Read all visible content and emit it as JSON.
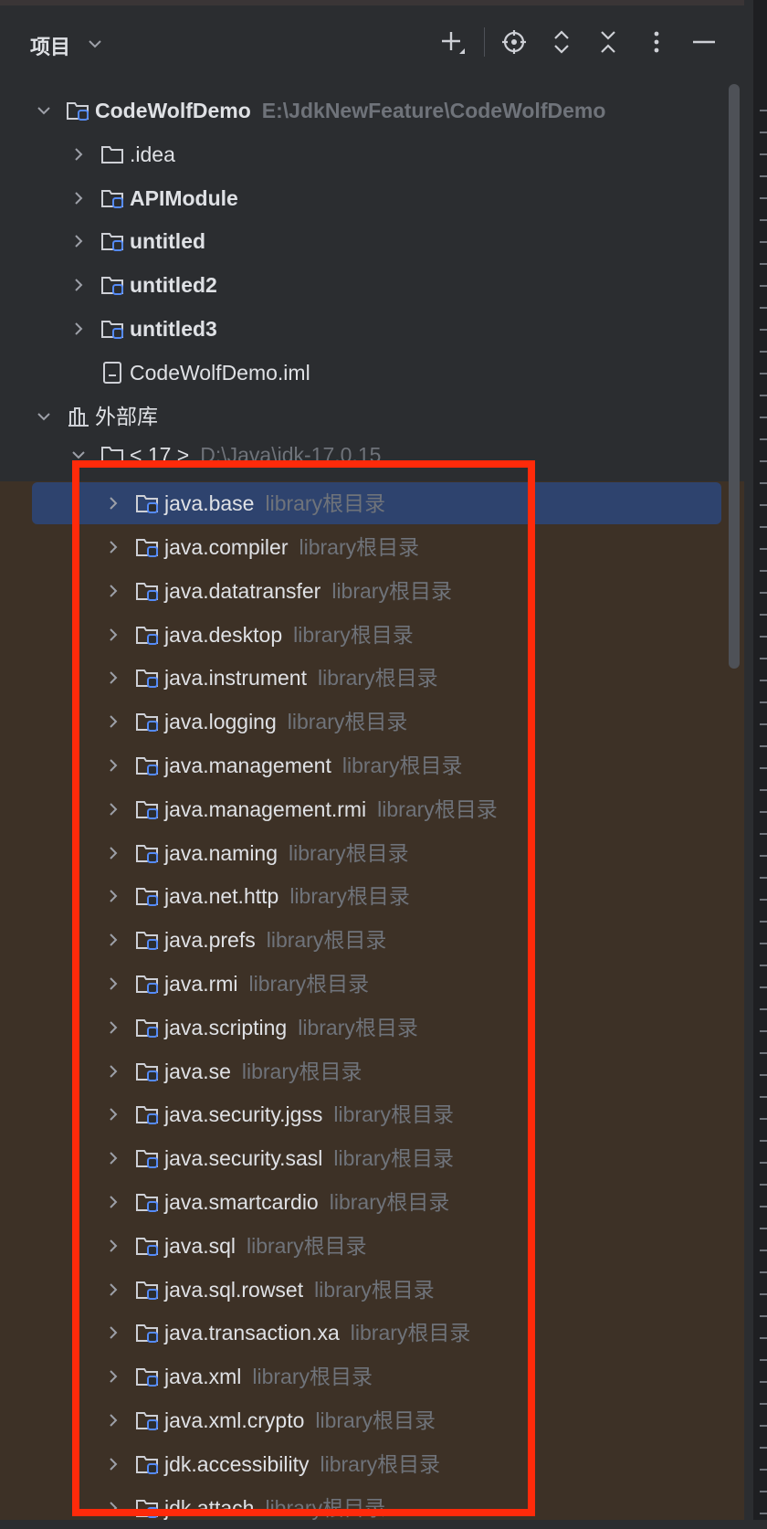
{
  "panel": {
    "title": "项目"
  },
  "toolbar": {
    "icons": [
      "add-icon",
      "locate-icon",
      "expand-icon",
      "collapse-icon",
      "more-icon",
      "minimize-icon"
    ]
  },
  "tree": {
    "root": {
      "name": "CodeWolfDemo",
      "path": "E:\\JdkNewFeature\\CodeWolfDemo"
    },
    "children": [
      ".idea",
      "APIModule",
      "untitled",
      "untitled2",
      "untitled3",
      "CodeWolfDemo.iml"
    ],
    "external": "外部库",
    "jdk": {
      "name": "< 17 >",
      "path": "D:\\Java\\jdk-17.0.15"
    },
    "hint": "library根目录",
    "modules": [
      "java.base",
      "java.compiler",
      "java.datatransfer",
      "java.desktop",
      "java.instrument",
      "java.logging",
      "java.management",
      "java.management.rmi",
      "java.naming",
      "java.net.http",
      "java.prefs",
      "java.rmi",
      "java.scripting",
      "java.se",
      "java.security.jgss",
      "java.security.sasl",
      "java.smartcardio",
      "java.sql",
      "java.sql.rowset",
      "java.transaction.xa",
      "java.xml",
      "java.xml.crypto",
      "jdk.accessibility",
      "jdk.attach"
    ]
  },
  "colors": {
    "selection": "#2e436e",
    "highlight_box": "#ff2a0a",
    "module_area": "#3d3126"
  }
}
